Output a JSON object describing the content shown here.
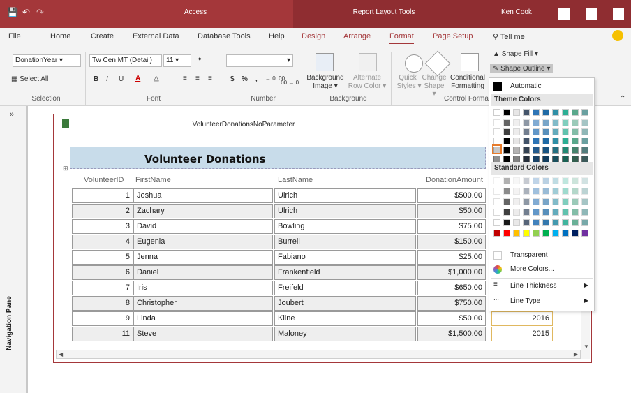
{
  "titlebar": {
    "app": "Access",
    "context": "Report Layout Tools",
    "user": "Ken Cook",
    "save_icon": "save-icon",
    "undo_icon": "undo-icon"
  },
  "tabs": [
    "File",
    "Home",
    "Create",
    "External Data",
    "Database Tools",
    "Help",
    "Design",
    "Arrange",
    "Format",
    "Page Setup"
  ],
  "tell_me": "Tell me",
  "ribbon": {
    "selection": {
      "field": "DonationYear",
      "select_all": "Select All",
      "label": "Selection"
    },
    "font": {
      "name": "Tw Cen MT (Detail)",
      "size": "11",
      "bold": "B",
      "italic": "I",
      "underline": "U",
      "label": "Font"
    },
    "number": {
      "currency": "$",
      "percent": "%",
      "comma": ",",
      "inc": "←.0 .00",
      "dec": ".00 →.0",
      "label": "Number"
    },
    "background": {
      "image_l1": "Background",
      "image_l2": "Image ▾",
      "alt_l1": "Alternate",
      "alt_l2": "Row Color ▾",
      "label": "Background"
    },
    "control": {
      "quick_l1": "Quick",
      "quick_l2": "Styles ▾",
      "change_l1": "Change",
      "change_l2": "Shape ▾",
      "cond_l1": "Conditional",
      "cond_l2": "Formatting",
      "label": "Control Format",
      "fill": "Shape Fill ▾",
      "outline": "Shape Outline ▾"
    }
  },
  "nav": {
    "label": "Navigation Pane",
    "chevron": "»"
  },
  "report": {
    "tab_title": "VolunteerDonationsNoParameter",
    "title": "Volunteer Donations",
    "columns": [
      "VolunteerID",
      "FirstName",
      "LastName",
      "DonationAmount"
    ],
    "rows": [
      {
        "id": "1",
        "first": "Joshua",
        "last": "Ulrich",
        "amount": "$500.00",
        "year": ""
      },
      {
        "id": "2",
        "first": "Zachary",
        "last": "Ulrich",
        "amount": "$50.00",
        "year": ""
      },
      {
        "id": "3",
        "first": "David",
        "last": "Bowling",
        "amount": "$75.00",
        "year": ""
      },
      {
        "id": "4",
        "first": "Eugenia",
        "last": "Burrell",
        "amount": "$150.00",
        "year": ""
      },
      {
        "id": "5",
        "first": "Jenna",
        "last": "Fabiano",
        "amount": "$25.00",
        "year": ""
      },
      {
        "id": "6",
        "first": "Daniel",
        "last": "Frankenfield",
        "amount": "$1,000.00",
        "year": ""
      },
      {
        "id": "7",
        "first": "Iris",
        "last": "Freifeld",
        "amount": "$650.00",
        "year": ""
      },
      {
        "id": "8",
        "first": "Christopher",
        "last": "Joubert",
        "amount": "$750.00",
        "year": "2015"
      },
      {
        "id": "9",
        "first": "Linda",
        "last": "Kline",
        "amount": "$50.00",
        "year": "2016"
      },
      {
        "id": "11",
        "first": "Steve",
        "last": "Maloney",
        "amount": "$1,500.00",
        "year": "2015"
      }
    ]
  },
  "dropdown": {
    "automatic": "Automatic",
    "theme_header": "Theme Colors",
    "standard_header": "Standard Colors",
    "transparent": "Transparent",
    "more_colors": "More Colors...",
    "line_thickness": "Line Thickness",
    "line_type": "Line Type",
    "theme_top": [
      "#ffffff",
      "#000000",
      "#e7e6e6",
      "#44546a",
      "#2e75b6",
      "#1f6aa5",
      "#2f8fa6",
      "#2dae94",
      "#5aa88c",
      "#6aa0a0"
    ],
    "standard": [
      "#c00000",
      "#ff0000",
      "#ffc000",
      "#ffff00",
      "#92d050",
      "#00b050",
      "#00b0f0",
      "#0070c0",
      "#002060",
      "#7030a0"
    ]
  }
}
